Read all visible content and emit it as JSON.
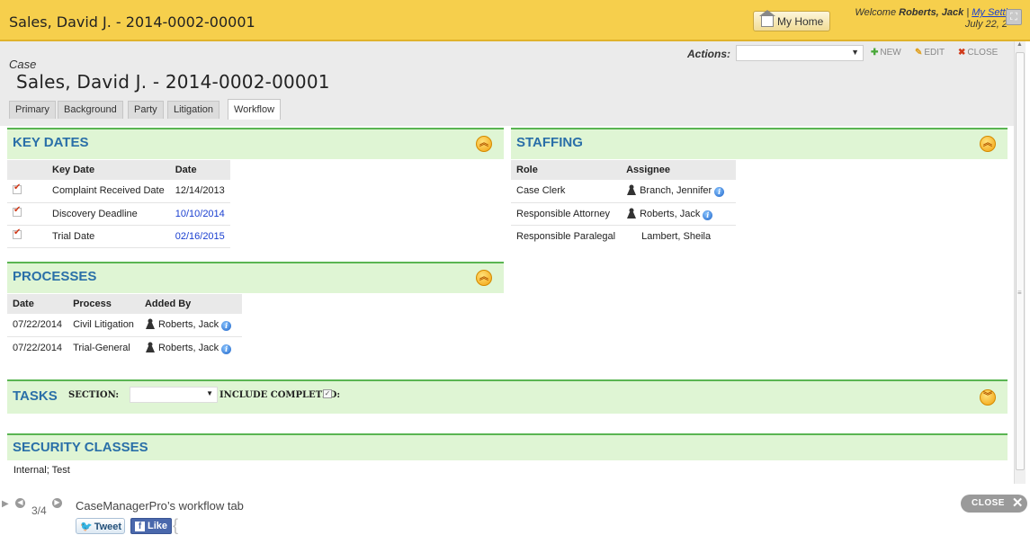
{
  "header": {
    "title": "Sales, David J. - 2014-0002-00001",
    "my_home": "My Home",
    "welcome_prefix": "Welcome ",
    "user": "Roberts, Jack",
    "separator": " | ",
    "my_settings": "My Setti",
    "date": "July 22, 2"
  },
  "case": {
    "label": "Case",
    "name": "Sales, David J. - 2014-0002-00001",
    "actions_label": "Actions:",
    "actions_value": "",
    "new_label": "NEW",
    "edit_label": "EDIT",
    "close_label": "CLOSE",
    "tabs": [
      {
        "label": "Primary"
      },
      {
        "label": "Background"
      },
      {
        "label": "Party"
      },
      {
        "label": "Litigation"
      },
      {
        "label": "Workflow",
        "active": true
      }
    ]
  },
  "key_dates": {
    "title": "KEY DATES",
    "columns": [
      "Key Date",
      "Date"
    ],
    "rows": [
      {
        "name": "Complaint Received Date",
        "date": "12/14/2013"
      },
      {
        "name": "Discovery Deadline",
        "date": "10/10/2014"
      },
      {
        "name": "Trial Date",
        "date": "02/16/2015"
      }
    ]
  },
  "staffing": {
    "title": "STAFFING",
    "columns": [
      "Role",
      "Assignee"
    ],
    "rows": [
      {
        "role": "Case Clerk",
        "assignee": "Branch, Jennifer"
      },
      {
        "role": "Responsible Attorney",
        "assignee": "Roberts, Jack"
      },
      {
        "role": "Responsible Paralegal",
        "assignee": "Lambert, Sheila"
      }
    ]
  },
  "processes": {
    "title": "PROCESSES",
    "columns": [
      "Date",
      "Process",
      "Added By"
    ],
    "rows": [
      {
        "date": "07/22/2014",
        "process": "Civil Litigation",
        "added_by": "Roberts, Jack"
      },
      {
        "date": "07/22/2014",
        "process": "Trial-General",
        "added_by": "Roberts, Jack"
      }
    ]
  },
  "tasks": {
    "title": "TASKS",
    "section_label": "SECTION:",
    "section_value": "",
    "include_completed_label": "INCLUDE COMPLETED:"
  },
  "security": {
    "title": "SECURITY CLASSES",
    "value": "Internal; Test"
  },
  "slideshow": {
    "count": "3/4",
    "caption": "CaseManagerPro’s workflow tab",
    "tweet": "Tweet",
    "like": "Like",
    "close": "CLOSE"
  },
  "colors": {
    "header_bg": "#f6cf4c",
    "panel_bg": "#dff5d4",
    "panel_border": "#5ab552",
    "panel_title": "#2a6fa8",
    "link": "#1a3fd0"
  }
}
